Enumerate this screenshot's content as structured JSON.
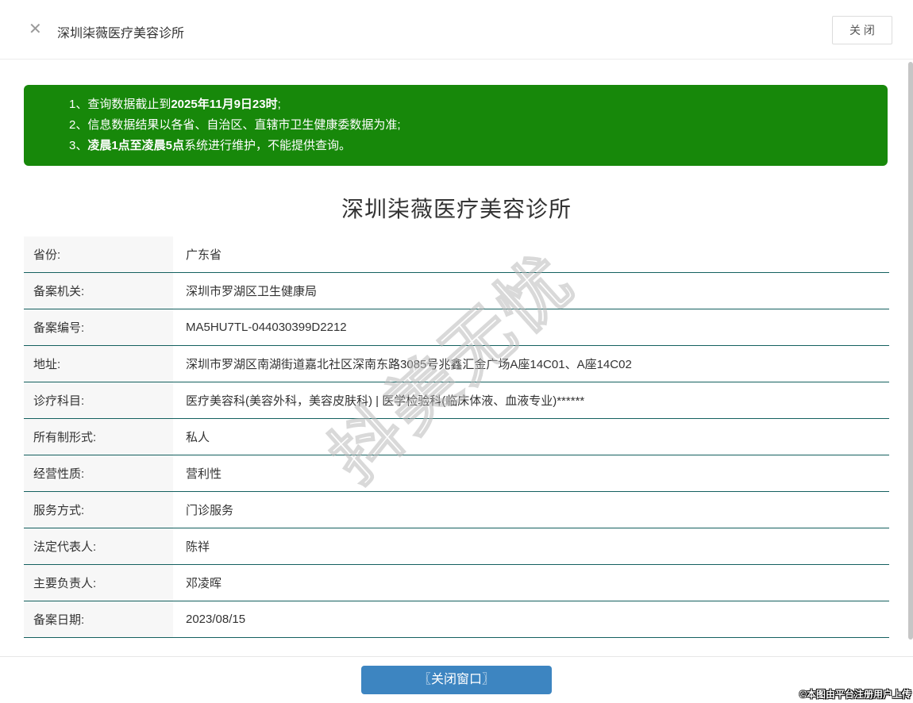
{
  "titlebar": {
    "title": "深圳柒薇医疗美容诊所",
    "close_icon_glyph": "✕",
    "close_button_label": "关 闭"
  },
  "notice": {
    "lines": [
      {
        "pre": "1、查询数据截止到",
        "bold": "2025年11月9日23时",
        "post": ";"
      },
      {
        "pre": "2、信息数据结果以各省、自治区、直辖市卫生健康委数据为准;",
        "bold": "",
        "post": ""
      },
      {
        "pre": "3、",
        "bold": "凌晨1点至凌晨5点",
        "post": "系统进行维护，不能提供查询。"
      }
    ]
  },
  "main": {
    "title": "深圳柒薇医疗美容诊所"
  },
  "table": {
    "rows": [
      {
        "label": "省份:",
        "value": "广东省"
      },
      {
        "label": "备案机关:",
        "value": "深圳市罗湖区卫生健康局"
      },
      {
        "label": "备案编号:",
        "value": "MA5HU7TL-044030399D2212"
      },
      {
        "label": "地址:",
        "value": "深圳市罗湖区南湖街道嘉北社区深南东路3085号兆鑫汇金广场A座14C01、A座14C02"
      },
      {
        "label": "诊疗科目:",
        "value": "医疗美容科(美容外科，美容皮肤科) | 医学检验科(临床体液、血液专业)******"
      },
      {
        "label": "所有制形式:",
        "value": "私人"
      },
      {
        "label": "经营性质:",
        "value": "营利性"
      },
      {
        "label": "服务方式:",
        "value": "门诊服务"
      },
      {
        "label": "法定代表人:",
        "value": "陈祥"
      },
      {
        "label": "主要负责人:",
        "value": "邓凌晖"
      },
      {
        "label": "备案日期:",
        "value": "2023/08/15"
      }
    ]
  },
  "footer": {
    "close_window_label": "〖关闭窗口〗"
  },
  "watermark_text": "抖美无忧",
  "copyright_text": "©本图由平台注册用户上传",
  "colors": {
    "notice_green": "#17880a",
    "button_blue": "#3d85c1",
    "row_separator": "#14605f",
    "label_bg": "#f7f7f7"
  }
}
